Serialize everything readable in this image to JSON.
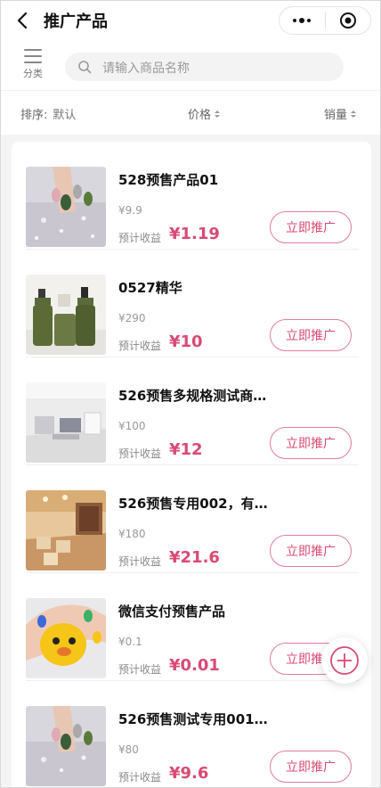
{
  "header": {
    "title": "推广产品"
  },
  "search": {
    "category_label": "分类",
    "placeholder": "请输入商品名称"
  },
  "sort": {
    "default_label": "排序:",
    "default_value": "默认",
    "price_label": "价格",
    "sales_label": "销量"
  },
  "products": [
    {
      "name": "528预售产品01",
      "price": "¥9.9",
      "earn_label": "预计收益",
      "earn_value": "¥1.19",
      "button": "立即推广",
      "thumb": "nail-art-glitter"
    },
    {
      "name": "0527精华",
      "price": "¥290",
      "earn_label": "预计收益",
      "earn_value": "¥10",
      "button": "立即推广",
      "thumb": "serum-bottles"
    },
    {
      "name": "526预售多规格测试商…",
      "price": "¥100",
      "earn_label": "预计收益",
      "earn_value": "¥12",
      "button": "立即推广",
      "thumb": "salon-room"
    },
    {
      "name": "526预售专用002，有…",
      "price": "¥180",
      "earn_label": "预计收益",
      "earn_value": "¥21.6",
      "button": "立即推广",
      "thumb": "wooden-studio"
    },
    {
      "name": "微信支付预售产品",
      "price": "¥0.1",
      "earn_label": "预计收益",
      "earn_value": "¥0.01",
      "button": "立即推广",
      "thumb": "cartoon-nails"
    },
    {
      "name": "526预售测试专用001…",
      "price": "¥80",
      "earn_label": "预计收益",
      "earn_value": "¥9.6",
      "button": "立即推广",
      "thumb": "nail-art-glitter"
    }
  ],
  "colors": {
    "accent": "#d94a74",
    "accent_border": "#e07d9e"
  },
  "icons": {
    "back": "chevron-left-icon",
    "more": "more-dots-icon",
    "close": "target-close-icon",
    "category": "list-icon",
    "search": "search-icon",
    "fab": "plus-circle-icon"
  }
}
